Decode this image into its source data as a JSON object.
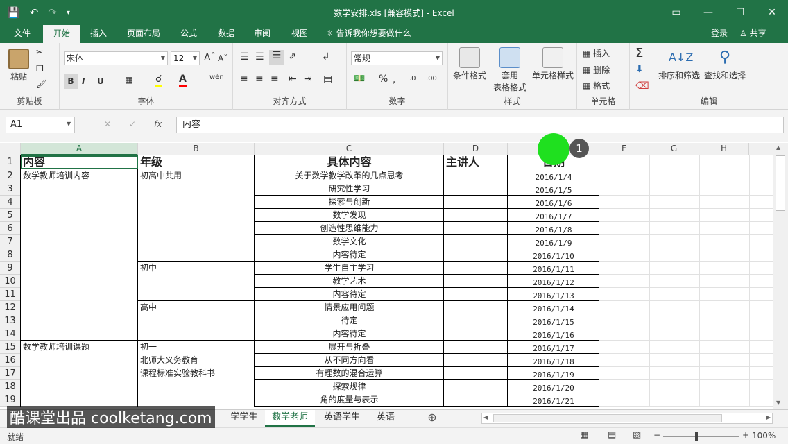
{
  "window": {
    "title": "数学安排.xls  [兼容模式] - Excel"
  },
  "tabs": [
    "文件",
    "开始",
    "插入",
    "页面布局",
    "公式",
    "数据",
    "审阅",
    "视图"
  ],
  "tell_me": "告诉我你想要做什么",
  "account": {
    "login": "登录",
    "share": "共享"
  },
  "ribbon": {
    "clipboard": {
      "label": "剪贴板",
      "paste": "粘贴"
    },
    "font": {
      "label": "字体",
      "font_name": "宋体",
      "font_size": "12",
      "bold": "B",
      "italic": "I",
      "underline": "U"
    },
    "alignment": {
      "label": "对齐方式"
    },
    "number": {
      "label": "数字",
      "format": "常规",
      "percent": "%"
    },
    "styles": {
      "label": "样式",
      "conditional": "条件格式",
      "table_1": "套用",
      "table_2": "表格格式",
      "cell_styles": "单元格样式"
    },
    "cells": {
      "label": "单元格",
      "insert": "插入",
      "delete": "删除",
      "format": "格式"
    },
    "editing": {
      "label": "编辑",
      "sort": "排序和筛选",
      "find": "查找和选择"
    }
  },
  "formula_bar": {
    "name_box": "A1",
    "fx": "fx",
    "content": "内容"
  },
  "columns": [
    "A",
    "B",
    "C",
    "D",
    "E",
    "F",
    "G",
    "H"
  ],
  "rows": [
    "1",
    "2",
    "3",
    "4",
    "5",
    "6",
    "7",
    "8",
    "9",
    "10",
    "11",
    "12",
    "13",
    "14",
    "15",
    "16",
    "17",
    "18",
    "19"
  ],
  "headers": {
    "a": "内容",
    "b": "年级",
    "c": "具体内容",
    "d": "主讲人",
    "e": "日期"
  },
  "col_a": {
    "group1": "数学教师培训内容",
    "group2": "数学教师培训课题"
  },
  "col_b": {
    "group1": "初高中共用",
    "group2": "初中",
    "group3": "高中",
    "group4_1": "初一",
    "group4_2": "北师大义务教育",
    "group4_3": "课程标准实验教科书"
  },
  "data_rows": [
    {
      "c": "关于数学教学改革的几点思考",
      "e": "2016/1/4"
    },
    {
      "c": "研究性学习",
      "e": "2016/1/5"
    },
    {
      "c": "探索与创新",
      "e": "2016/1/6"
    },
    {
      "c": "数学发现",
      "e": "2016/1/7"
    },
    {
      "c": "创造性思维能力",
      "e": "2016/1/8"
    },
    {
      "c": "数学文化",
      "e": "2016/1/9"
    },
    {
      "c": "内容待定",
      "e": "2016/1/10"
    },
    {
      "c": "学生自主学习",
      "e": "2016/1/11"
    },
    {
      "c": "教学艺术",
      "e": "2016/1/12"
    },
    {
      "c": "内容待定",
      "e": "2016/1/13"
    },
    {
      "c": "情景应用问题",
      "e": "2016/1/14"
    },
    {
      "c": "待定",
      "e": "2016/1/15"
    },
    {
      "c": "内容待定",
      "e": "2016/1/16"
    },
    {
      "c": "展开与折叠",
      "e": "2016/1/17"
    },
    {
      "c": "从不同方向看",
      "e": "2016/1/18"
    },
    {
      "c": "有理数的混合运算",
      "e": "2016/1/19"
    },
    {
      "c": "探索规律",
      "e": "2016/1/20"
    },
    {
      "c": "角的度量与表示",
      "e": "2016/1/21"
    }
  ],
  "sheets": [
    "学学生",
    "数学老师",
    "英语学生",
    "英语"
  ],
  "status": {
    "ready": "就绪",
    "zoom": "100%"
  },
  "watermark": "酷课堂出品 coolketang.com",
  "marker_number": "1",
  "colors": {
    "excel_green": "#217346",
    "marker_green": "#1fe01f"
  }
}
